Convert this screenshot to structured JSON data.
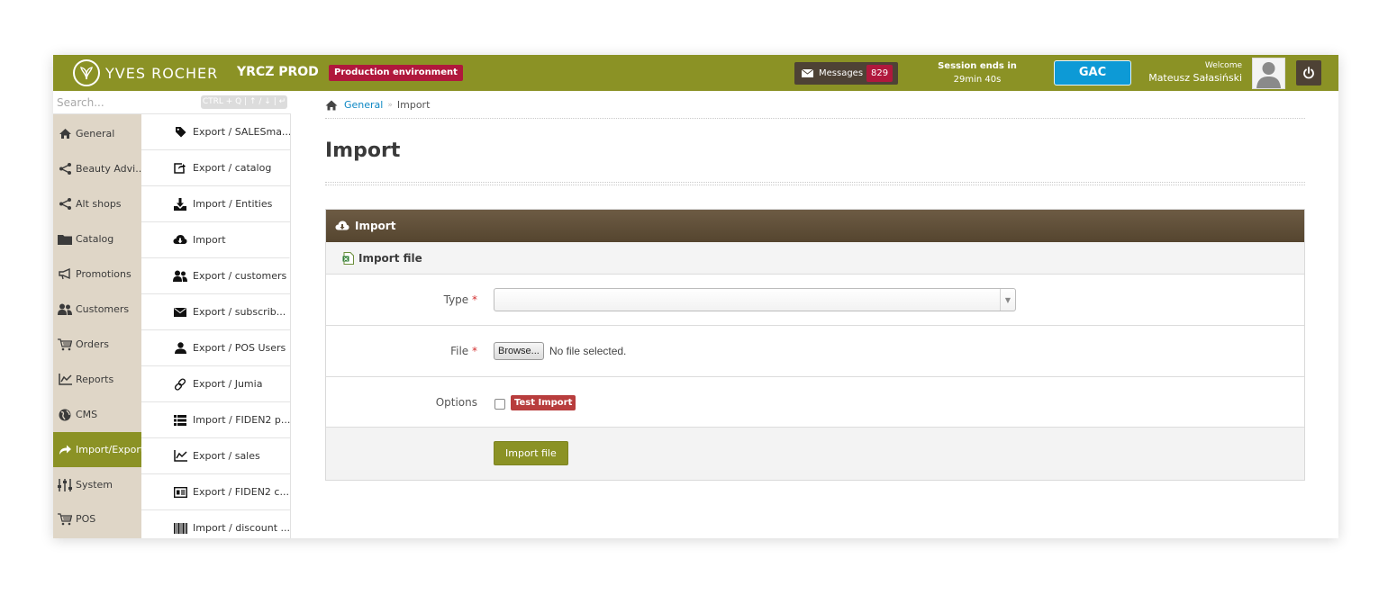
{
  "header": {
    "logo_text": "YVES ROCHER",
    "prod_name": "YRCZ PROD",
    "environment": "Production environment",
    "messages_label": "Messages",
    "messages_count": "829",
    "session_label": "Session ends in",
    "session_time": "29min 40s",
    "gac_label": "GAC",
    "welcome_label": "Welcome",
    "user_name": "Mateusz Sałasiński"
  },
  "search": {
    "placeholder": "Search...",
    "shortcut": "CTRL + Q | ↑ / ↓ | ↵"
  },
  "main_nav": [
    {
      "label": "General",
      "icon": "home-icon"
    },
    {
      "label": "Beauty Advi...",
      "icon": "share-icon"
    },
    {
      "label": "Alt shops",
      "icon": "share-icon"
    },
    {
      "label": "Catalog",
      "icon": "folder-icon"
    },
    {
      "label": "Promotions",
      "icon": "megaphone-icon"
    },
    {
      "label": "Customers",
      "icon": "users-icon"
    },
    {
      "label": "Orders",
      "icon": "cart-icon"
    },
    {
      "label": "Reports",
      "icon": "chart-icon"
    },
    {
      "label": "CMS",
      "icon": "globe-icon"
    },
    {
      "label": "Import/Export",
      "icon": "share-arrow-icon",
      "active": true
    },
    {
      "label": "System",
      "icon": "sliders-icon"
    },
    {
      "label": "POS",
      "icon": "cart-icon"
    }
  ],
  "sub_nav": [
    {
      "label": "Export / SALESma...",
      "icon": "tag-icon"
    },
    {
      "label": "Export / catalog",
      "icon": "external-link-icon"
    },
    {
      "label": "Import / Entities",
      "icon": "download-icon"
    },
    {
      "label": "Import",
      "icon": "cloud-download-icon",
      "current": true
    },
    {
      "label": "Export / customers",
      "icon": "users-icon"
    },
    {
      "label": "Export / subscrib...",
      "icon": "envelope-icon"
    },
    {
      "label": "Export / POS Users",
      "icon": "user-icon"
    },
    {
      "label": "Export / Jumia",
      "icon": "link-icon"
    },
    {
      "label": "Import / FIDEN2 p...",
      "icon": "list-icon"
    },
    {
      "label": "Export / sales",
      "icon": "chart-icon"
    },
    {
      "label": "Export / FIDEN2 c...",
      "icon": "id-card-icon"
    },
    {
      "label": "Import / discount ...",
      "icon": "barcode-icon"
    }
  ],
  "breadcrumb": {
    "home_link": "General",
    "current": "Import"
  },
  "page_title": "Import",
  "panel": {
    "title": "Import",
    "subtitle": "Import file",
    "type_label": "Type",
    "required_mark": "*",
    "file_label": "File",
    "browse_label": "Browse...",
    "no_file_text": "No file selected.",
    "options_label": "Options",
    "test_import_label": "Test Import",
    "submit_label": "Import file"
  },
  "colors": {
    "brand_green": "#8b9225",
    "panel_brown": "#5e4d37",
    "nav_beige": "#dfd6c7",
    "alert_red": "#b0183c",
    "gac_blue": "#0d9ad6"
  }
}
